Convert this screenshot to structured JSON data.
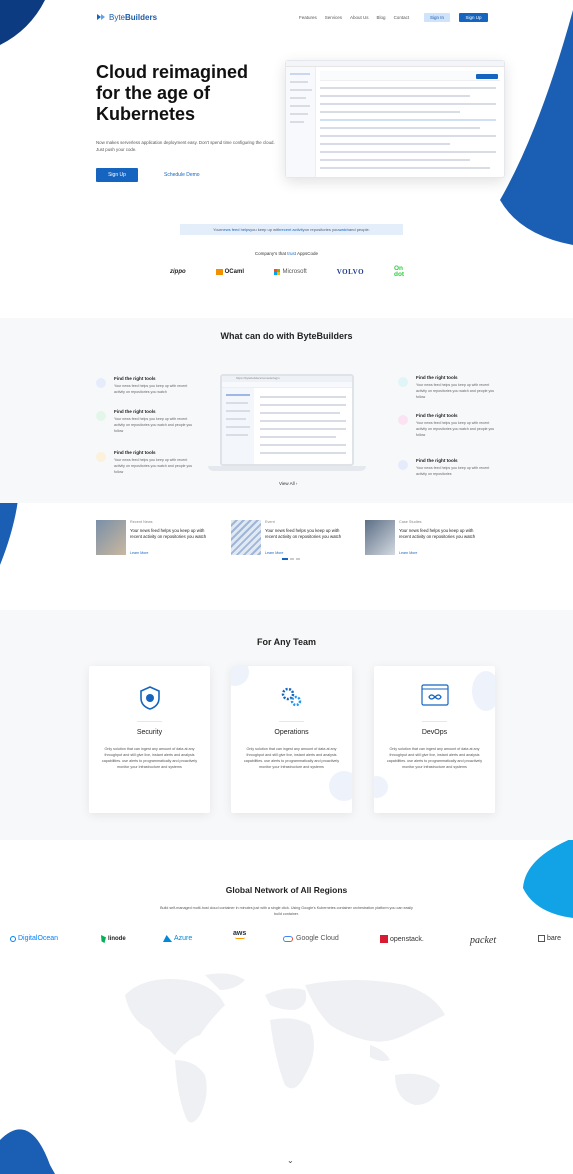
{
  "brand": {
    "name_prefix": "Byte",
    "name_suffix": "Builders",
    "color": "#1565c0"
  },
  "nav": {
    "items": [
      "Features",
      "Services",
      "About Us",
      "Blog",
      "Contact"
    ],
    "sign_in": "Sign In",
    "sign_up": "Sign Up"
  },
  "hero": {
    "title": "Cloud reimagined for the age of Kubernetes",
    "subtitle": "Now makes serverless application deployment easy. Don't spend time configuring the cloud. Just push your code.",
    "cta_primary": "Sign Up",
    "cta_secondary": "Schedule Demo"
  },
  "banner": {
    "pre": "Your ",
    "link1": "news feed helps",
    "mid": " you keep up with ",
    "link2": "recent activity",
    "post": " on repositories you ",
    "link3": "watch",
    "end": " and people."
  },
  "trust": {
    "title_pre": "Company's that ",
    "title_link": "trust",
    "title_post": " AppsCode",
    "logos": [
      "zippo",
      "OCaml",
      "Microsoft",
      "VOLVO",
      "On dot"
    ]
  },
  "features": {
    "title": "What can do with ByteBuilders",
    "items": [
      {
        "title": "Find the right tools",
        "desc": "Your news feed helps you keep up with recent activity on repositories you watch",
        "color": "#5b7fe0"
      },
      {
        "title": "Find the right tools",
        "desc": "Your news feed helps you keep up with recent activity on repositories you watch and people you follow",
        "color": "#2fbf71"
      },
      {
        "title": "Find the right tools",
        "desc": "Your news feed helps you keep up with recent activity on repositories you watch and people you follow",
        "color": "#f2b42a"
      },
      {
        "title": "Find the right tools",
        "desc": "Your news feed helps you keep up with recent activity on repositories you watch and people you follow",
        "color": "#27b3c7"
      },
      {
        "title": "Find the right tools",
        "desc": "Your news feed helps you keep up with recent activity on repositories you watch and people you follow",
        "color": "#e24ab8"
      },
      {
        "title": "Find the right tools",
        "desc": "Your news feed helps you keep up with recent activity on repositories",
        "color": "#4a6ae0"
      }
    ],
    "mock_url": "https://bytebuilders/console/login",
    "view_all": "View All  ›"
  },
  "news": [
    {
      "category": "Recent News",
      "text": "Your news feed helps you keep up with recent activity on repositories you watch",
      "more": "Learn More"
    },
    {
      "category": "Event",
      "text": "Your news feed helps you keep up with recent activity on repositories you watch",
      "more": "Learn More"
    },
    {
      "category": "Case Studies",
      "text": "Your news feed helps you keep up with recent activity on repositories you watch",
      "more": "Learn More"
    }
  ],
  "teams": {
    "title": "For Any Team",
    "cards": [
      {
        "title": "Security",
        "desc": "Only solution that can ingest any amount of data at any throughput and still give live, instant alerts and analysis capabilities. use alerts to programmatically and proactively monitor your infrastructure and systems",
        "icon": "shield-icon"
      },
      {
        "title": "Operations",
        "desc": "Only solution that can ingest any amount of data at any throughput and still give live, instant alerts and analysis capabilities. use alerts to programmatically and proactively monitor your infrastructure and systems",
        "icon": "gears-icon"
      },
      {
        "title": "DevOps",
        "desc": "Only solution that can ingest any amount of data at any throughput and still give live, instant alerts and analysis capabilities. use alerts to programmatically and proactively monitor your infrastructure and systems",
        "icon": "infinity-icon"
      }
    ]
  },
  "global": {
    "title": "Global Network of All  Regions",
    "subtitle": "Build self-managed multi-host cloud container in minutes just with a single click. Using Google's Kubernetes container orchestration platform you can easily build container.",
    "providers": [
      "DigitalOcean",
      "linode",
      "Azure",
      "aws",
      "Google Cloud",
      "openstack.",
      "packet",
      "bare"
    ]
  },
  "footer": {
    "chevron": "⌄"
  }
}
